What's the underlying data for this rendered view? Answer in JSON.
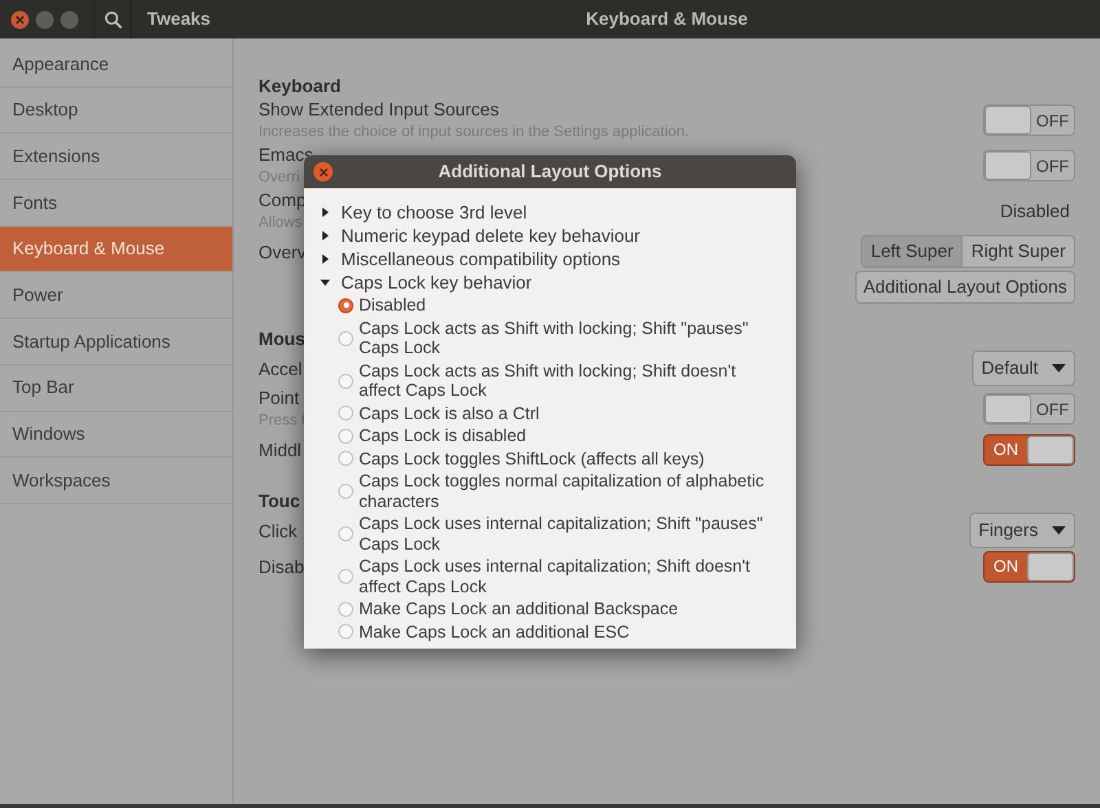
{
  "window": {
    "app_title": "Tweaks",
    "title": "Keyboard & Mouse"
  },
  "sidebar": {
    "items": [
      {
        "label": "Appearance",
        "selected": false
      },
      {
        "label": "Desktop",
        "selected": false
      },
      {
        "label": "Extensions",
        "selected": false
      },
      {
        "label": "Fonts",
        "selected": false
      },
      {
        "label": "Keyboard & Mouse",
        "selected": true
      },
      {
        "label": "Power",
        "selected": false
      },
      {
        "label": "Startup Applications",
        "selected": false
      },
      {
        "label": "Top Bar",
        "selected": false
      },
      {
        "label": "Windows",
        "selected": false
      },
      {
        "label": "Workspaces",
        "selected": false
      }
    ]
  },
  "sections": [
    {
      "heading": "Keyboard",
      "rows": [
        {
          "kind": "switch",
          "label": "Show Extended Input Sources",
          "description": "Increases the choice of input sources in the Settings application.",
          "on": false,
          "state_label": "OFF"
        },
        {
          "kind": "switch",
          "label": "Emacs",
          "description": "Overri",
          "on": false,
          "state_label": "OFF"
        },
        {
          "kind": "value",
          "label": "Comp",
          "description": "Allows",
          "value": "Disabled"
        },
        {
          "kind": "segmented",
          "label": "Overv",
          "options": [
            {
              "label": "Left Super",
              "selected": true
            },
            {
              "label": "Right Super",
              "selected": false
            }
          ]
        },
        {
          "kind": "button",
          "label": "Additional Layout Options"
        }
      ]
    },
    {
      "heading": "Mous",
      "rows": [
        {
          "kind": "dropdown",
          "label": "Accel",
          "value": "Default"
        },
        {
          "kind": "switch",
          "label": "Point",
          "description": "Press t",
          "on": false,
          "state_label": "OFF"
        },
        {
          "kind": "switch",
          "label": "Middl",
          "on": true,
          "state_label": "ON"
        }
      ]
    },
    {
      "heading": "Touc",
      "rows": [
        {
          "kind": "dropdown",
          "label": "Click",
          "value": "Fingers"
        },
        {
          "kind": "switch",
          "label": "Disab",
          "on": true,
          "state_label": "ON"
        }
      ]
    }
  ],
  "dialog": {
    "title": "Additional Layout Options",
    "options": [
      {
        "label": "Key to choose 3rd level",
        "expanded": false
      },
      {
        "label": "Numeric keypad delete key behaviour",
        "expanded": false
      },
      {
        "label": "Miscellaneous compatibility options",
        "expanded": false
      },
      {
        "label": "Caps Lock key behavior",
        "expanded": true,
        "children": [
          {
            "label": "Disabled",
            "selected": true
          },
          {
            "label": "Caps Lock acts as Shift with locking; Shift \"pauses\" Caps Lock",
            "selected": false
          },
          {
            "label": "Caps Lock acts as Shift with locking; Shift doesn't affect Caps Lock",
            "selected": false
          },
          {
            "label": "Caps Lock is also a Ctrl",
            "selected": false
          },
          {
            "label": "Caps Lock is disabled",
            "selected": false
          },
          {
            "label": "Caps Lock toggles ShiftLock (affects all keys)",
            "selected": false
          },
          {
            "label": "Caps Lock toggles normal capitalization of alphabetic characters",
            "selected": false
          },
          {
            "label": "Caps Lock uses internal capitalization; Shift \"pauses\" Caps Lock",
            "selected": false
          },
          {
            "label": "Caps Lock uses internal capitalization; Shift doesn't affect Caps Lock",
            "selected": false
          },
          {
            "label": "Make Caps Lock an additional Backspace",
            "selected": false
          },
          {
            "label": "Make Caps Lock an additional ESC",
            "selected": false
          }
        ]
      }
    ]
  }
}
